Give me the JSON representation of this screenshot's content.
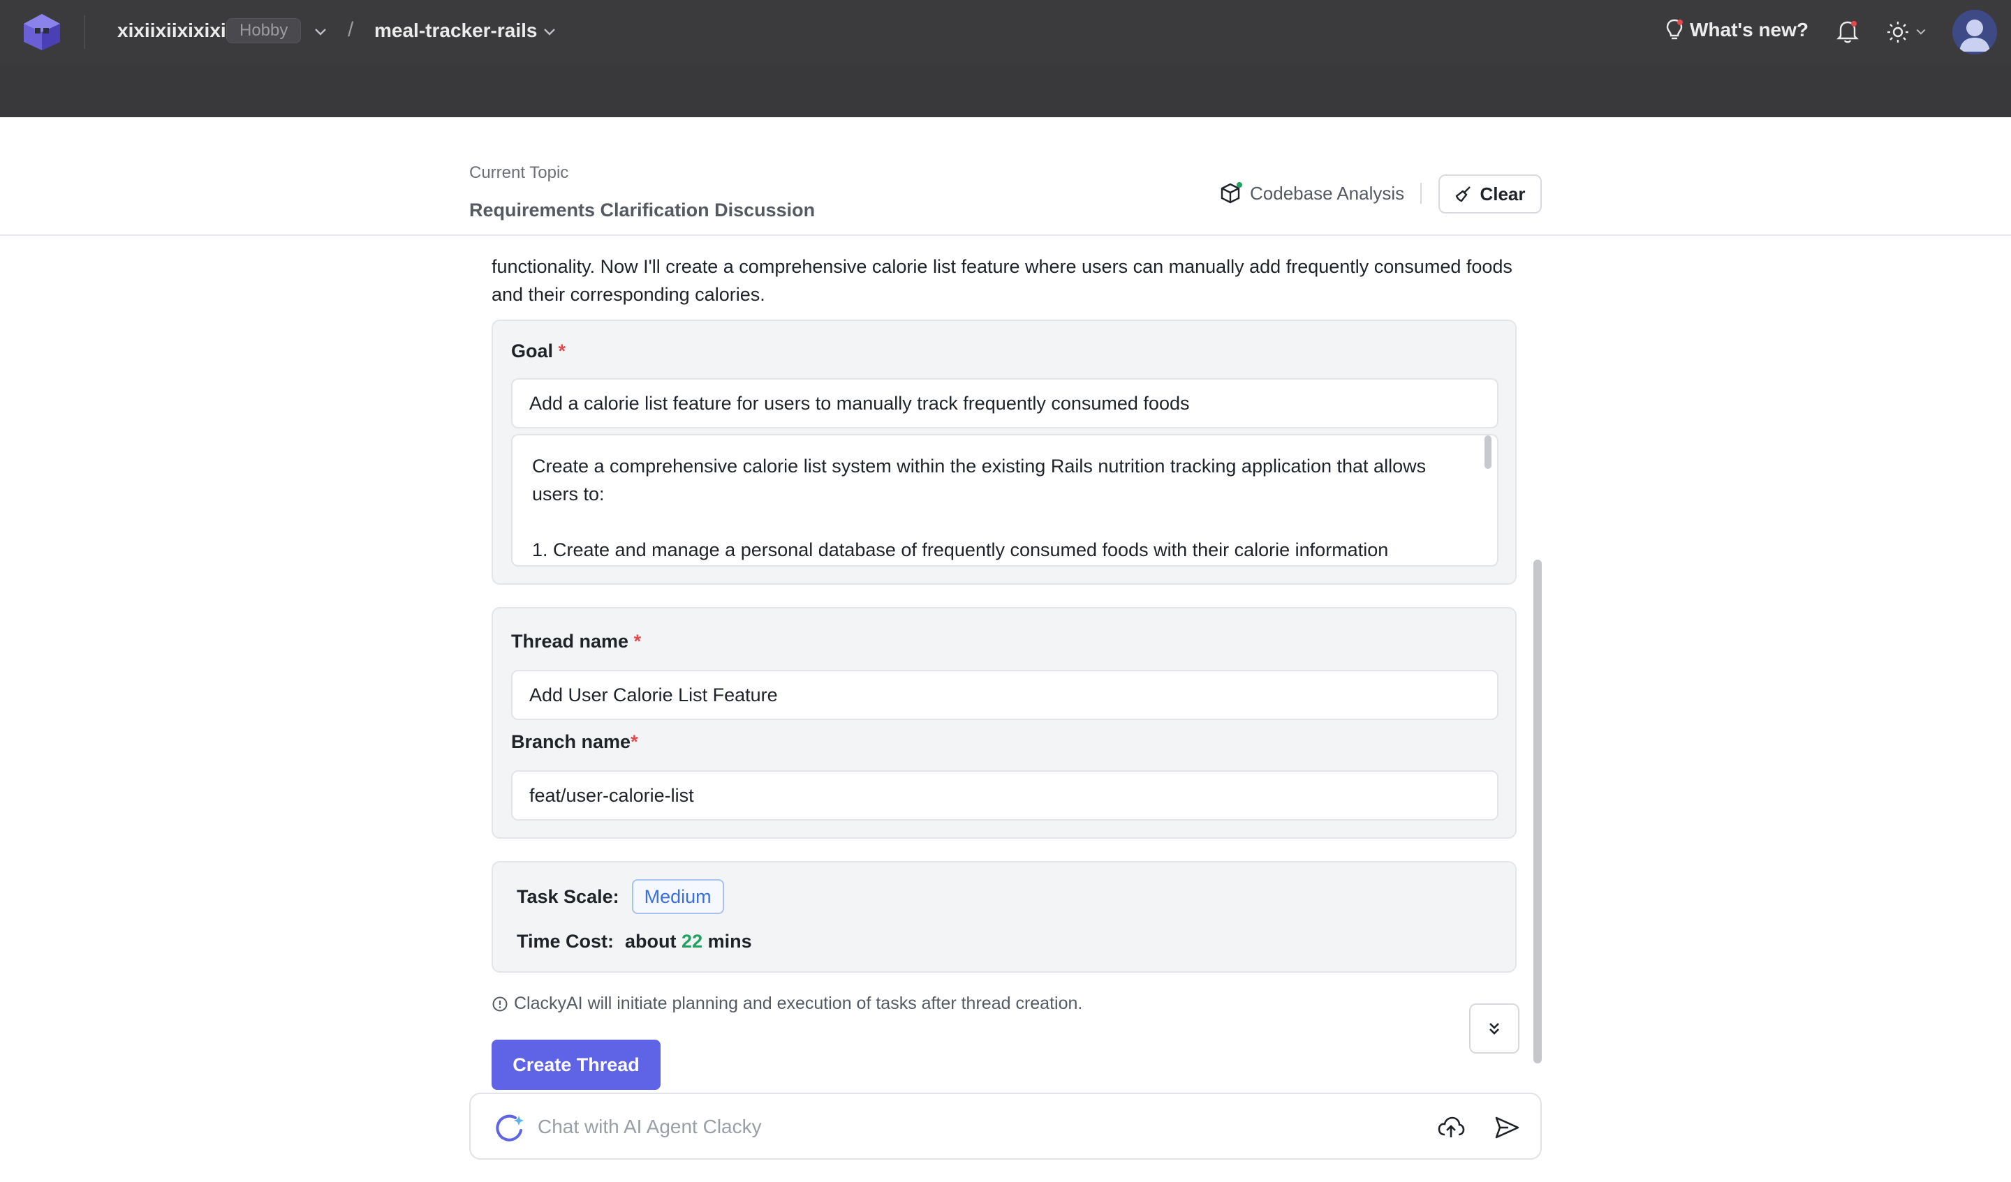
{
  "topbar": {
    "org_name": "xixiixiixixixi",
    "plan_badge": "Hobby",
    "breadcrumb_separator": "/",
    "project_name": "meal-tracker-rails",
    "whats_new": "What's new?"
  },
  "header": {
    "topic_label": "Current Topic",
    "topic_title": "Requirements Clarification Discussion",
    "codebase_analysis": "Codebase Analysis",
    "clear_label": "Clear"
  },
  "main": {
    "intro_text": "functionality. Now I'll create a comprehensive calorie list feature where users can manually add frequently consumed foods and their corresponding calories.",
    "goal": {
      "label": "Goal",
      "required_mark": "*",
      "value": "Add a calorie list feature for users to manually track frequently consumed foods",
      "description_line1": "Create a comprehensive calorie list system within the existing Rails nutrition tracking application that allows users to:",
      "description_line2": "1. Create and manage a personal database of frequently consumed foods with their calorie information"
    },
    "thread": {
      "label": "Thread name",
      "required_mark": "*",
      "value": "Add User Calorie List Feature"
    },
    "branch": {
      "label": "Branch name",
      "required_mark": "*",
      "value": "feat/user-calorie-list"
    },
    "task": {
      "scale_label": "Task Scale:",
      "scale_value": "Medium",
      "time_label": "Time Cost:",
      "time_prefix": "about",
      "time_value": "22",
      "time_unit": "mins"
    },
    "note": "ClackyAI will initiate planning and execution of tasks after thread creation.",
    "create_button": "Create Thread"
  },
  "chat": {
    "placeholder": "Chat with AI Agent Clacky"
  },
  "colors": {
    "topbar_bg": "#3b3b3d",
    "accent": "#5f63e6",
    "required": "#e5484d",
    "time_value": "#22a061",
    "badge_text": "#3b6fd9"
  }
}
